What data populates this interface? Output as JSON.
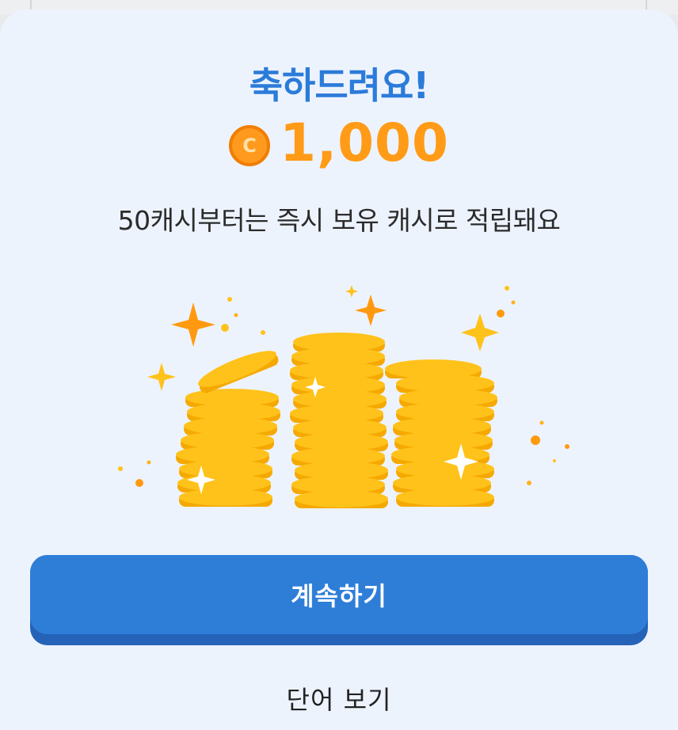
{
  "reward": {
    "title": "축하드려요!",
    "coin_symbol": "C",
    "amount": "1,000",
    "description": "50캐시부터는 즉시 보유 캐시로 적립돼요"
  },
  "illustration": {
    "icon": "coin-stacks-with-sparkles",
    "colors": {
      "coin": "#ffc21a",
      "coin_shadow": "#f5a900",
      "sparkle": "#ffb31a",
      "sparkle_dark": "#ff9a10"
    }
  },
  "actions": {
    "continue_label": "계속하기",
    "word_view_label": "단어 보기"
  },
  "colors": {
    "title": "#2b7bd9",
    "amount": "#ff9b16",
    "button": "#2e7ed8",
    "button_shadow": "#2563b8",
    "sheet_background": "#edf3fd"
  }
}
